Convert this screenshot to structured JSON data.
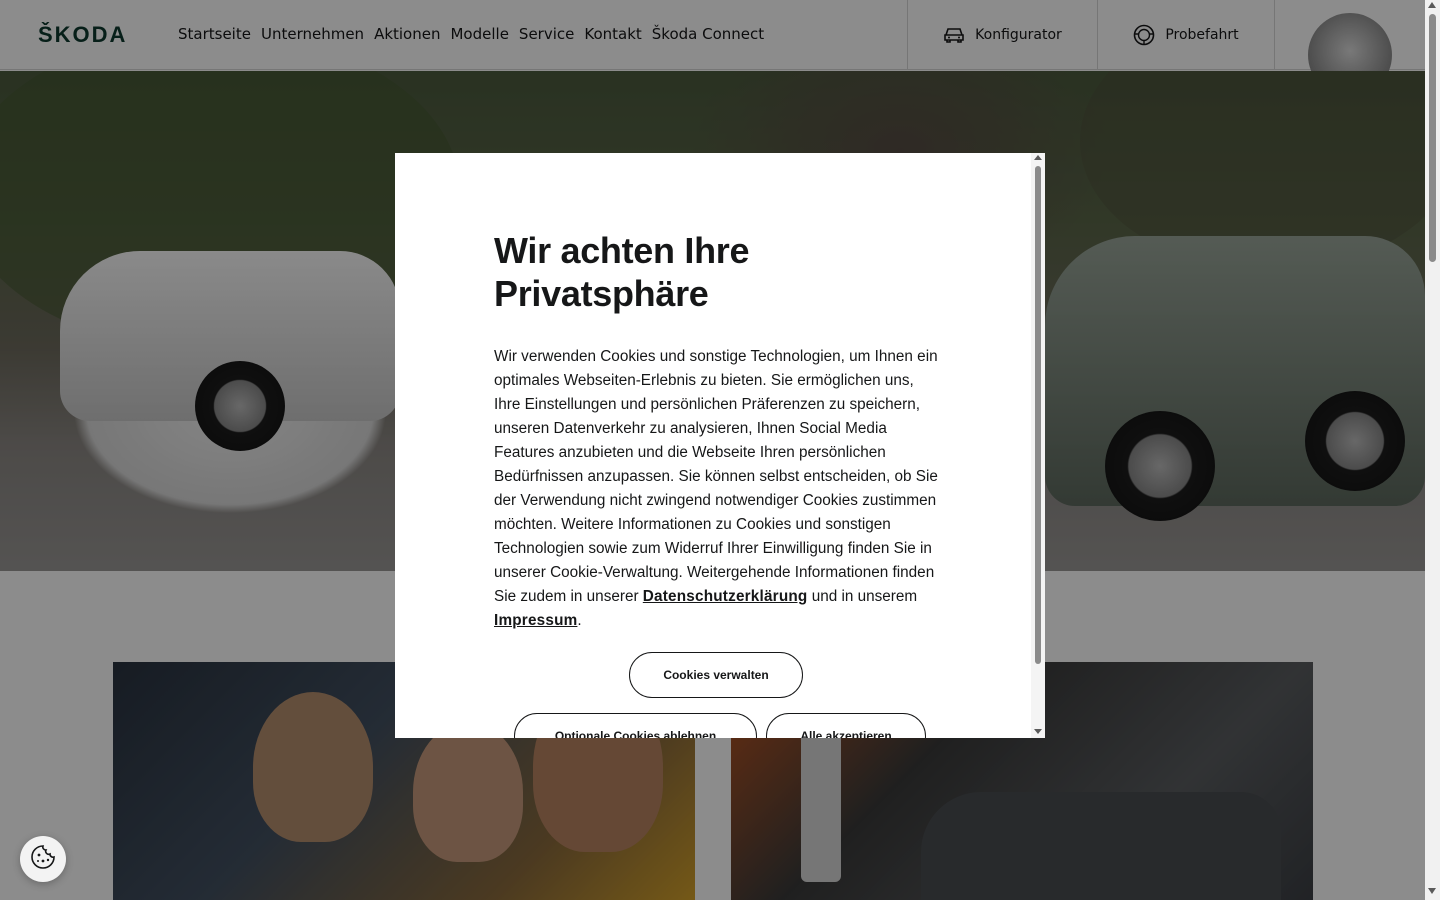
{
  "header": {
    "logo_text": "ŠKODA",
    "nav": [
      "Startseite",
      "Unternehmen",
      "Aktionen",
      "Modelle",
      "Service",
      "Kontakt",
      "Škoda Connect"
    ],
    "konfigurator_label": "Konfigurator",
    "probefahrt_label": "Probefahrt"
  },
  "modal": {
    "title": "Wir achten Ihre Privatsphäre",
    "body": "Wir verwenden Cookies und sonstige Technologien, um Ihnen ein optimales Webseiten-Erlebnis zu bieten. Sie ermöglichen uns, Ihre Einstellungen und persönlichen Präferenzen zu speichern, unseren Datenverkehr zu analysieren, Ihnen Social Media Features anzubieten und die Webseite Ihren persönlichen Bedürfnissen anzupassen. Sie können selbst entscheiden, ob Sie der Verwendung nicht zwingend notwendiger Cookies zustimmen möchten. Weitere Informationen zu Cookies und sonstigen Technologien sowie zum Widerruf Ihrer Einwilligung finden Sie in unserer Cookie-Verwaltung. Weitergehende Informationen finden Sie zudem in unserer",
    "privacy_link": "Datenschutzerklärung",
    "between": "und in unserem",
    "imprint_link": "Impressum",
    "end": ".",
    "manage_label": "Cookies verwalten",
    "reject_label": "Optionale Cookies ablehnen",
    "accept_label": "Alle akzeptieren"
  },
  "colors": {
    "brand_green": "#0e3a2f",
    "overlay": "rgba(0,0,0,0.45)",
    "text": "#161718"
  },
  "icons": [
    "car-icon",
    "steering-wheel-icon",
    "cookie-icon"
  ]
}
